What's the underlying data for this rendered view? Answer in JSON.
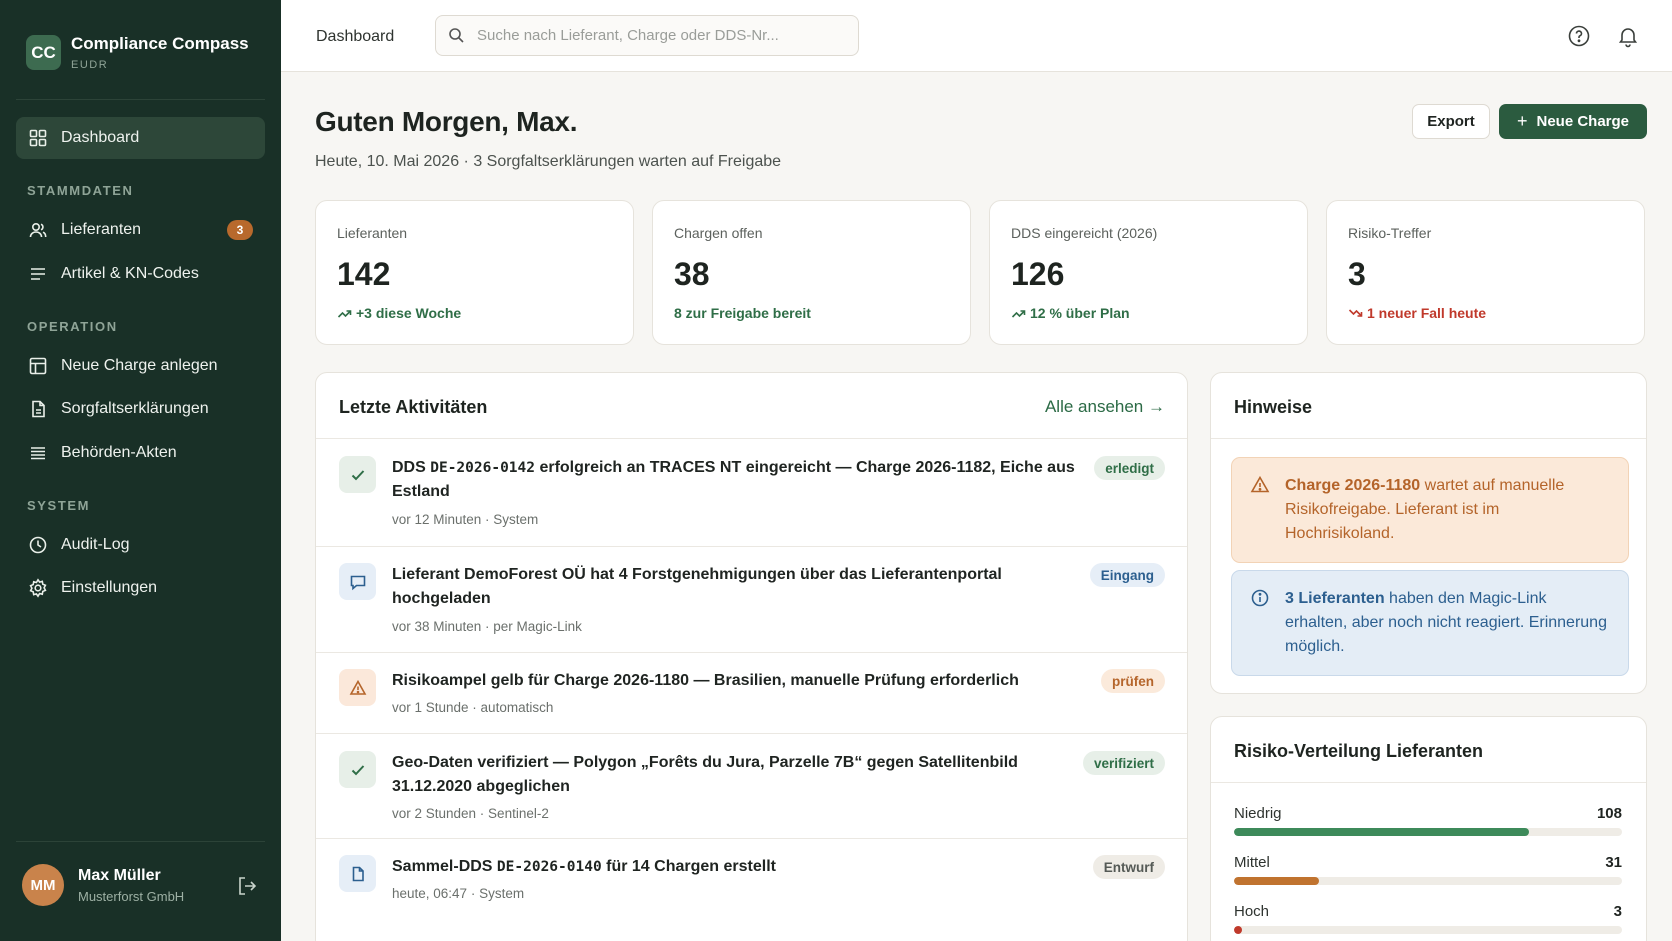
{
  "brand": {
    "logo": "CC",
    "name": "Compliance Compass",
    "sub": "EUDR"
  },
  "sidebar": {
    "dashboard": "Dashboard",
    "sections": {
      "stammdaten": "STAMMDATEN",
      "operation": "OPERATION",
      "system": "SYSTEM"
    },
    "items": {
      "lieferanten": "Lieferanten",
      "lieferanten_badge": "3",
      "artikel": "Artikel & KN-Codes",
      "neue_charge": "Neue Charge anlegen",
      "sorgfalt": "Sorgfaltserklärungen",
      "behoerden": "Behörden-Akten",
      "audit": "Audit-Log",
      "einstellungen": "Einstellungen"
    },
    "icons": {
      "dashboard": "grid-icon",
      "lieferanten": "users-icon",
      "artikel": "list-icon",
      "neue_charge": "layout-icon",
      "sorgfalt": "document-icon",
      "behoerden": "menu-icon",
      "audit": "clock-icon",
      "einstellungen": "gear-icon"
    }
  },
  "user": {
    "initials": "MM",
    "name": "Max Müller",
    "org": "Musterforst GmbH"
  },
  "topbar": {
    "breadcrumb": "Dashboard",
    "search_placeholder": "Suche nach Lieferant, Charge oder DDS-Nr..."
  },
  "header": {
    "greeting": "Guten Morgen, Max.",
    "subline": "Heute, 10. Mai 2026 · 3 Sorgfaltserklärungen warten auf Freigabe",
    "export": "Export",
    "new_charge": "Neue Charge"
  },
  "stats": [
    {
      "label": "Lieferanten",
      "value": "142",
      "trend": "+3 diese Woche",
      "tone": "green"
    },
    {
      "label": "Chargen offen",
      "value": "38",
      "trend": "8 zur Freigabe bereit",
      "tone": "green"
    },
    {
      "label": "DDS eingereicht (2026)",
      "value": "126",
      "trend": "12 % über Plan",
      "tone": "green"
    },
    {
      "label": "Risiko-Treffer",
      "value": "3",
      "trend": "1 neuer Fall heute",
      "tone": "red"
    }
  ],
  "activities": {
    "title": "Letzte Aktivitäten",
    "see_all": "Alle ansehen →",
    "items": [
      {
        "p1": "DDS ",
        "code": "DE-2026-0142",
        "p2": " erfolgreich an TRACES NT eingereicht — Charge 2026-1182, Eiche aus Estland",
        "meta": "vor 12 Minuten · System",
        "tag": "erledigt"
      },
      {
        "p1": "Lieferant ",
        "bold": "DemoForest OÜ",
        "p2": " hat 4 Forstgenehmigungen über das Lieferantenportal hochgeladen",
        "meta": "vor 38 Minuten · per Magic-Link",
        "tag": "Eingang"
      },
      {
        "p1": "Risikoampel ",
        "bold": "gelb",
        "p2": " für Charge 2026-1180 — Brasilien, manuelle Prüfung erforderlich",
        "meta": "vor 1 Stunde · automatisch",
        "tag": "prüfen"
      },
      {
        "p1": "Geo-Daten verifiziert — Polygon „Forêts du Jura, Parzelle 7B“ gegen Satellitenbild 31.12.2020 abgeglichen",
        "meta": "vor 2 Stunden · Sentinel-2",
        "tag": "verifiziert"
      },
      {
        "p1": "Sammel-DDS ",
        "code": "DE-2026-0140",
        "p2": " für 14 Chargen erstellt",
        "meta": "heute, 06:47 · System",
        "tag": "Entwurf"
      }
    ]
  },
  "hints": {
    "title": "Hinweise",
    "warn": {
      "bold": "Charge 2026-1180",
      "text": " wartet auf manuelle Risikofreigabe. Lieferant ist im Hochrisikoland."
    },
    "info": {
      "bold": "3 Lieferanten",
      "text": " haben den Magic-Link erhalten, aber noch nicht reagiert. Erinnerung möglich."
    }
  },
  "risk": {
    "title": "Risiko-Verteilung Lieferanten",
    "rows": [
      {
        "label": "Niedrig",
        "count": "108",
        "fraction": 0.76,
        "color": "#3d8a5a"
      },
      {
        "label": "Mittel",
        "count": "31",
        "fraction": 0.22,
        "color": "#c0732f"
      },
      {
        "label": "Hoch",
        "count": "3",
        "fraction": 0.02,
        "color": "#c0392b"
      }
    ]
  }
}
